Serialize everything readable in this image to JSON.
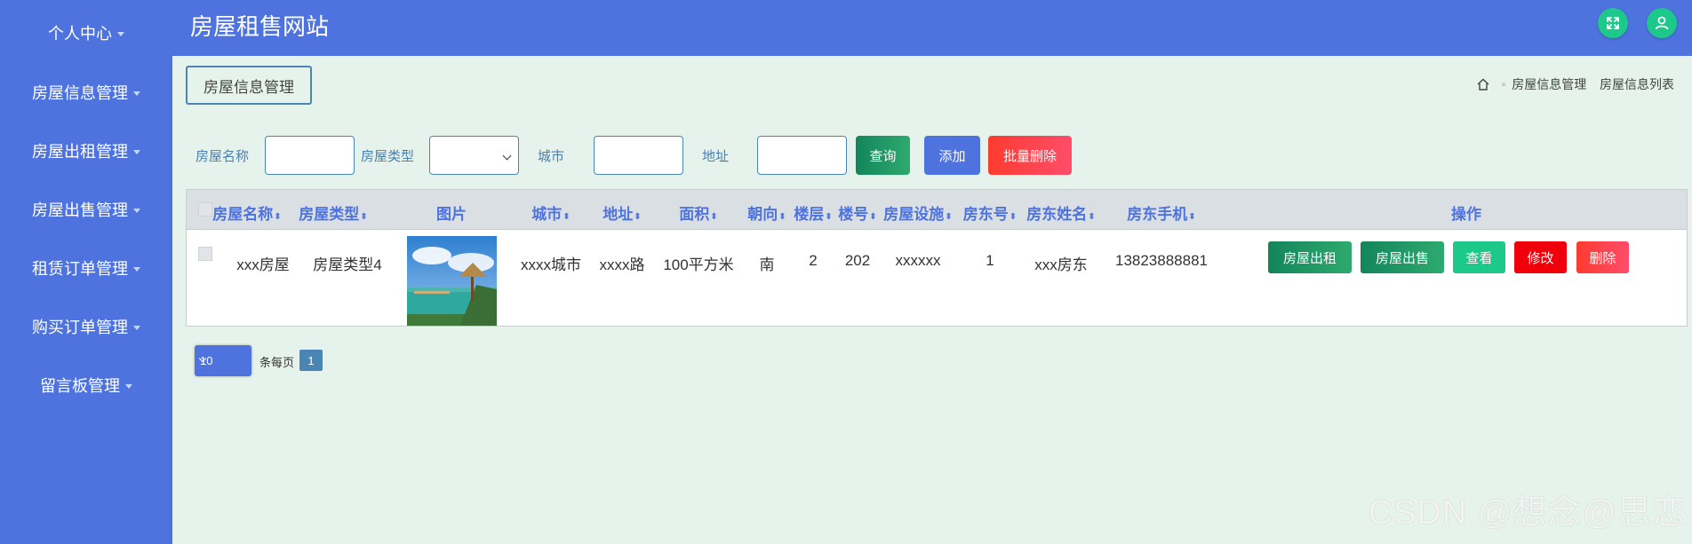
{
  "app": {
    "title": "房屋租售网站"
  },
  "sidebar": {
    "items": [
      {
        "label": "个人中心"
      },
      {
        "label": "房屋信息管理"
      },
      {
        "label": "房屋出租管理"
      },
      {
        "label": "房屋出售管理"
      },
      {
        "label": "租赁订单管理"
      },
      {
        "label": "购买订单管理"
      },
      {
        "label": "留言板管理"
      }
    ]
  },
  "header": {
    "fullscreen_icon": "expand-icon",
    "user_icon": "user-icon",
    "accent": "#4e73df",
    "icon_bg": "#1cc88a"
  },
  "page": {
    "tag": "房屋信息管理",
    "breadcrumb": [
      "房屋信息管理",
      "房屋信息列表"
    ]
  },
  "search": {
    "name_label": "房屋名称",
    "name_value": "",
    "type_label": "房屋类型",
    "type_value": "",
    "city_label": "城市",
    "city_value": "",
    "address_label": "地址",
    "address_value": "",
    "query_btn": "查询",
    "add_btn": "添加",
    "batch_delete_btn": "批量删除"
  },
  "table": {
    "columns": [
      "房屋名称",
      "房屋类型",
      "图片",
      "城市",
      "地址",
      "面积",
      "朝向",
      "楼层",
      "楼号",
      "房屋设施",
      "房东号",
      "房东姓名",
      "房东手机",
      "操作"
    ],
    "rows": [
      {
        "name": "xxx房屋",
        "type": "房屋类型4",
        "city": "xxxx城市",
        "address": "xxxx路",
        "area": "100平方米",
        "orientation": "南",
        "floor": "2",
        "building": "202",
        "facilities": "xxxxxx",
        "landlord_no": "1",
        "landlord_name": "xxx房东",
        "landlord_phone": "13823888881",
        "actions": {
          "rent": "房屋出租",
          "sell": "房屋出售",
          "view": "查看",
          "edit": "修改",
          "delete": "删除"
        }
      }
    ]
  },
  "pagination": {
    "page_size": "10",
    "per_page_label": "条每页",
    "current_page": "1"
  },
  "watermark": "CSDN @想念@思恋"
}
